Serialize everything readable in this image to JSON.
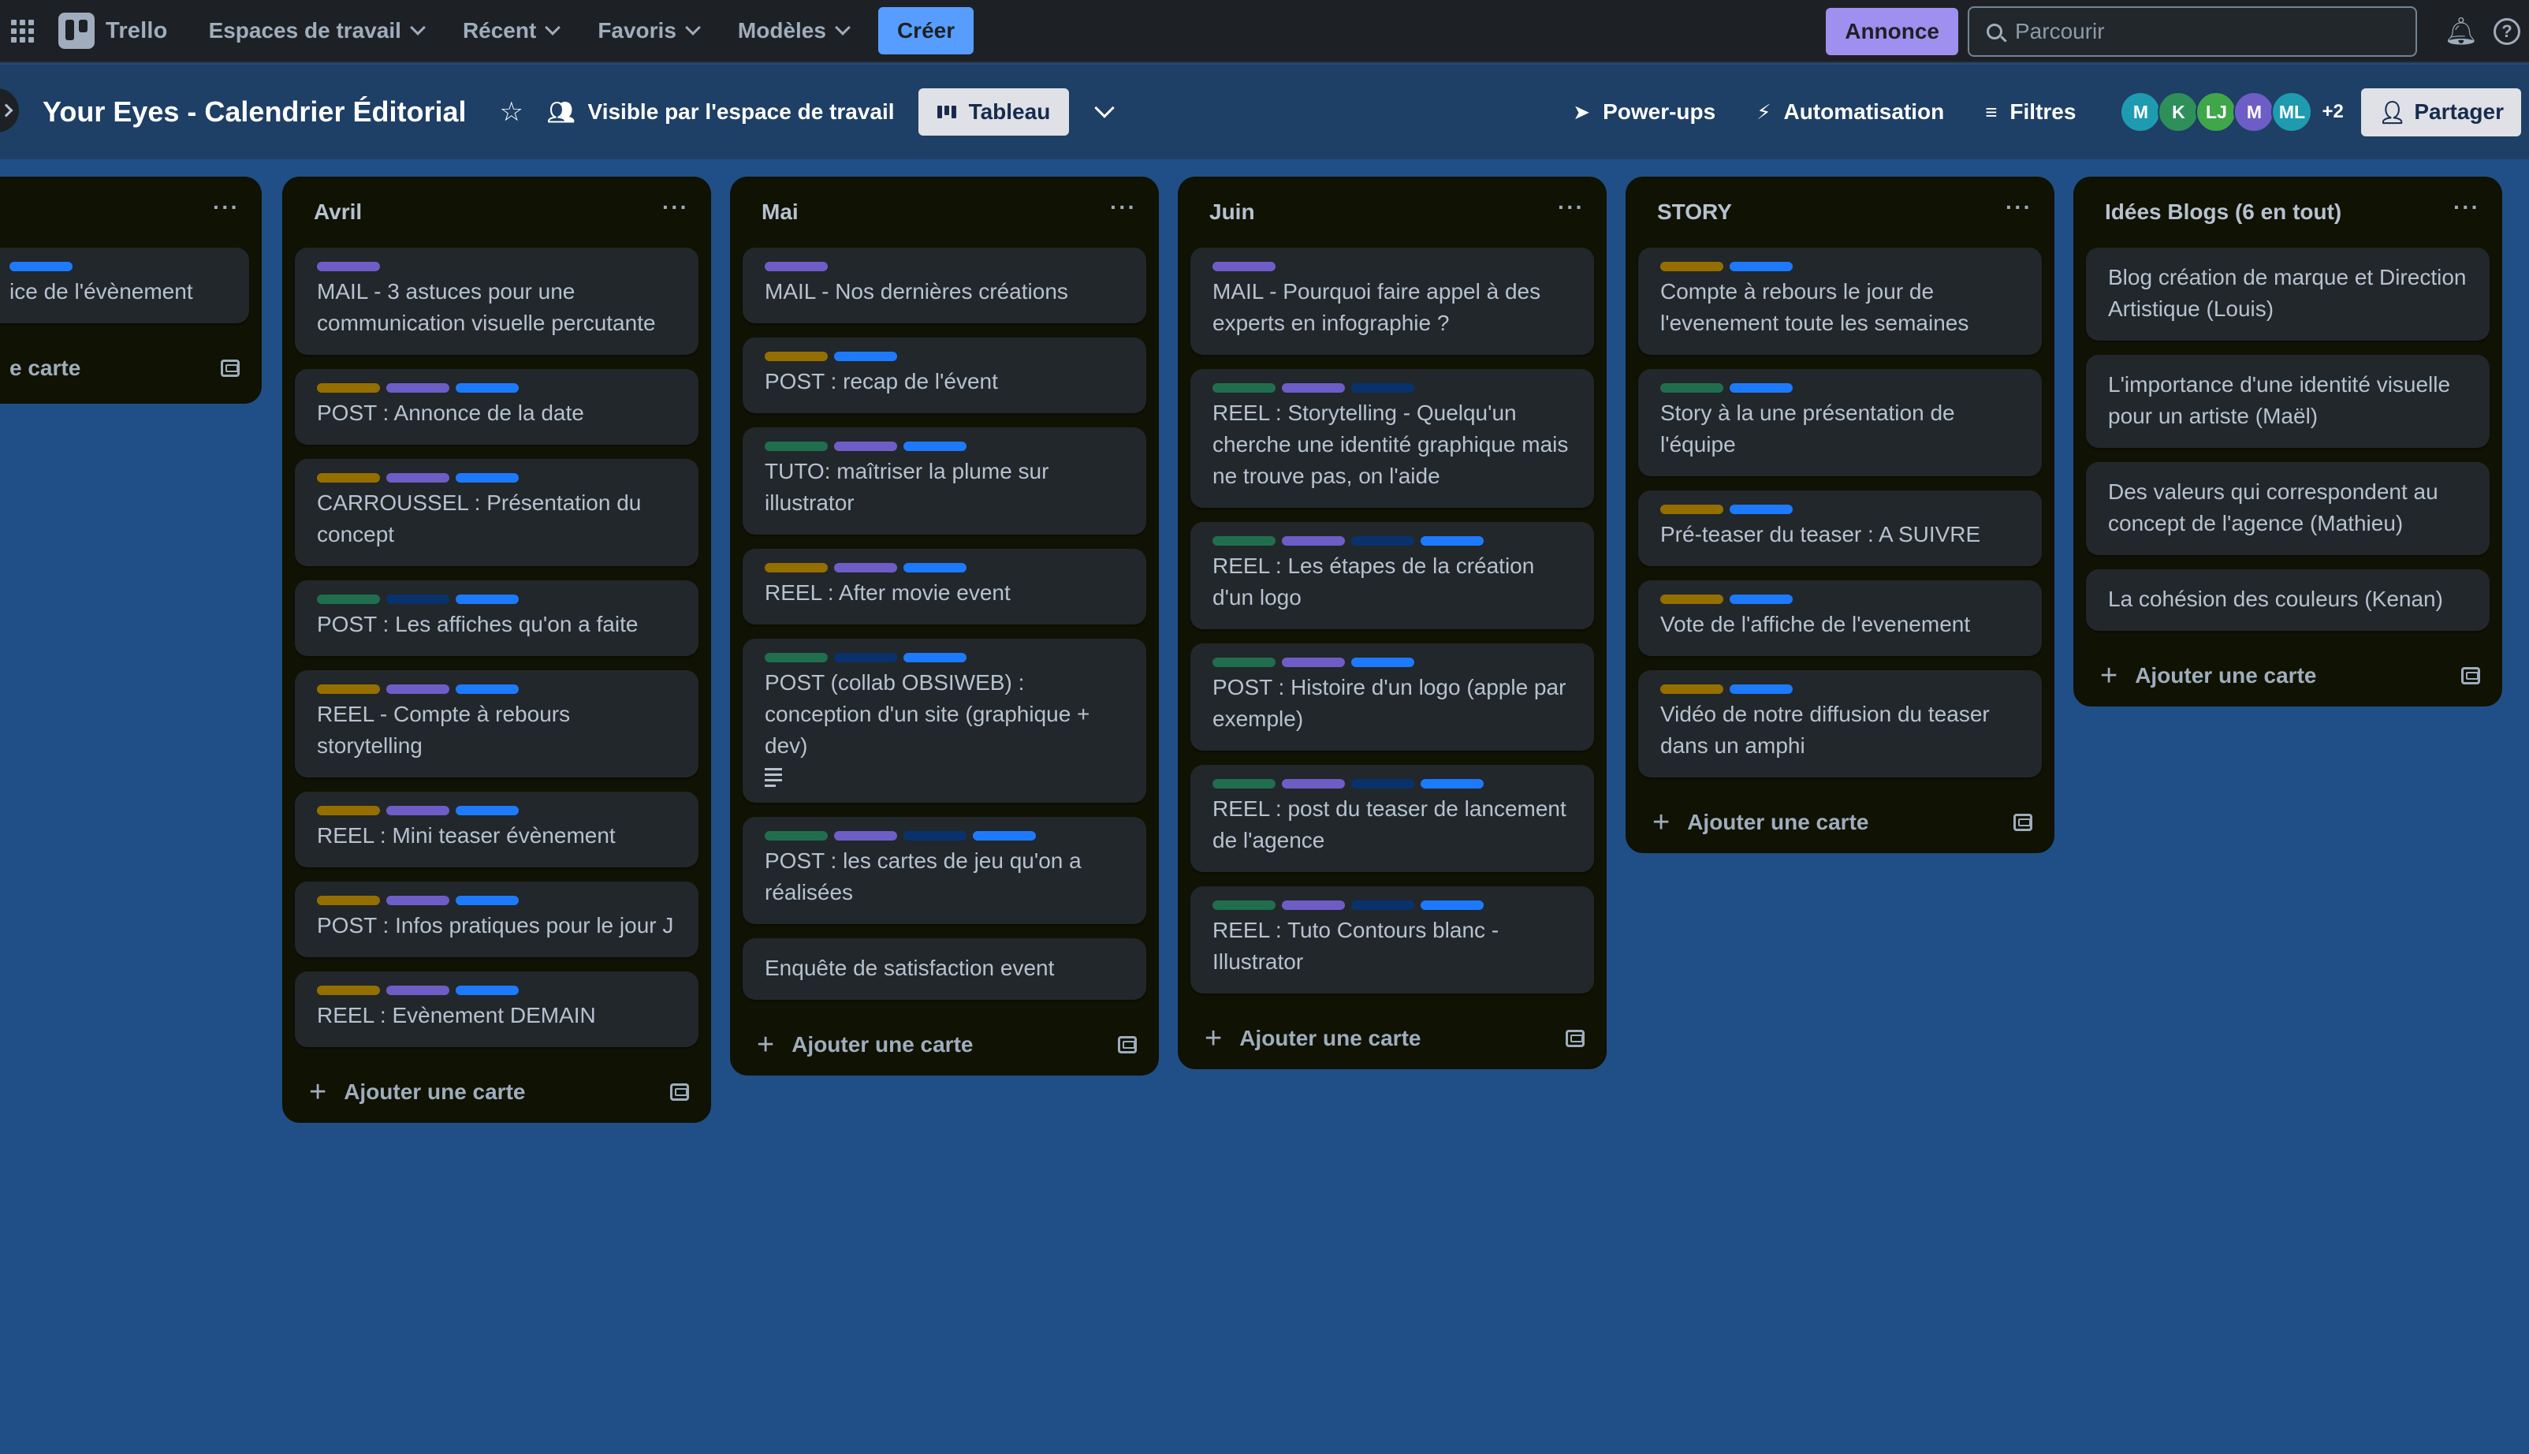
{
  "topnav": {
    "logo": "Trello",
    "menu": [
      "Espaces de travail",
      "Récent",
      "Favoris",
      "Modèles"
    ],
    "create": "Créer",
    "announce": "Annonce",
    "search_placeholder": "Parcourir"
  },
  "board": {
    "title": "Your Eyes - Calendrier Éditorial",
    "visibility": "Visible par l'espace de travail",
    "view": "Tableau",
    "powerups": "Power-ups",
    "automation": "Automatisation",
    "filters": "Filtres",
    "members": [
      {
        "initials": "M",
        "color": "#1f9bb0"
      },
      {
        "initials": "K",
        "color": "#2f8f5b"
      },
      {
        "initials": "LJ",
        "color": "#3fa64a"
      },
      {
        "initials": "M",
        "color": "#6e5dc6"
      },
      {
        "initials": "ML",
        "color": "#1f9bb0"
      }
    ],
    "more_members": "+2",
    "share": "Partager"
  },
  "add_card_label": "Ajouter une carte",
  "partial_list": {
    "card_fragment": "ice de l'évènement",
    "add_fragment": "e carte",
    "labels": [
      "blue"
    ]
  },
  "lists": [
    {
      "title": "Avril",
      "cards": [
        {
          "text": "MAIL - 3 astuces pour une communication visuelle percutante",
          "labels": [
            "purple"
          ]
        },
        {
          "text": "POST : Annonce de la date",
          "labels": [
            "yellow",
            "purple",
            "blue"
          ]
        },
        {
          "text": "CARROUSSEL : Présentation du concept",
          "labels": [
            "yellow",
            "purple",
            "blue"
          ]
        },
        {
          "text": "POST : Les affiches qu'on a faite",
          "labels": [
            "green",
            "navy",
            "blue"
          ]
        },
        {
          "text": "REEL - Compte à rebours storytelling",
          "labels": [
            "yellow",
            "purple",
            "blue"
          ]
        },
        {
          "text": "REEL : Mini teaser évènement",
          "labels": [
            "yellow",
            "purple",
            "blue"
          ]
        },
        {
          "text": "POST : Infos pratiques pour le jour J",
          "labels": [
            "yellow",
            "purple",
            "blue"
          ]
        },
        {
          "text": "REEL : Evènement DEMAIN",
          "labels": [
            "yellow",
            "purple",
            "blue"
          ]
        }
      ]
    },
    {
      "title": "Mai",
      "cards": [
        {
          "text": "MAIL - Nos dernières créations",
          "labels": [
            "purple"
          ]
        },
        {
          "text": "POST : recap de l'évent",
          "labels": [
            "yellow",
            "blue"
          ]
        },
        {
          "text": "TUTO: maîtriser la plume sur illustrator",
          "labels": [
            "green",
            "purple",
            "blue"
          ]
        },
        {
          "text": "REEL : After movie event",
          "labels": [
            "yellow",
            "purple",
            "blue"
          ]
        },
        {
          "text": "POST (collab OBSIWEB) : conception d'un site (graphique + dev)",
          "labels": [
            "green",
            "navy",
            "blue"
          ],
          "has_description": true
        },
        {
          "text": "POST : les cartes de jeu qu'on a réalisées",
          "labels": [
            "green",
            "purple",
            "navy",
            "blue"
          ]
        },
        {
          "text": "Enquête de satisfaction event",
          "labels": []
        }
      ]
    },
    {
      "title": "Juin",
      "cards": [
        {
          "text": "MAIL - Pourquoi faire appel à des experts en infographie ?",
          "labels": [
            "purple"
          ]
        },
        {
          "text": "REEL : Storytelling - Quelqu'un cherche une identité graphique mais ne trouve pas, on l'aide",
          "labels": [
            "green",
            "purple",
            "navy"
          ]
        },
        {
          "text": "REEL : Les étapes de la création d'un logo",
          "labels": [
            "green",
            "purple",
            "navy",
            "blue"
          ]
        },
        {
          "text": "POST : Histoire d'un logo (apple par exemple)",
          "labels": [
            "green",
            "purple",
            "blue"
          ]
        },
        {
          "text": "REEL : post du teaser de lancement de l'agence",
          "labels": [
            "green",
            "purple",
            "navy",
            "blue"
          ]
        },
        {
          "text": "REEL : Tuto Contours blanc - Illustrator",
          "labels": [
            "green",
            "purple",
            "navy",
            "blue"
          ]
        }
      ]
    },
    {
      "title": "STORY",
      "cards": [
        {
          "text": "Compte à rebours le jour de l'evenement toute les semaines",
          "labels": [
            "yellow",
            "blue"
          ]
        },
        {
          "text": "Story à la une présentation de l'équipe",
          "labels": [
            "green",
            "blue"
          ]
        },
        {
          "text": "Pré-teaser du teaser : A SUIVRE",
          "labels": [
            "yellow",
            "blue"
          ]
        },
        {
          "text": "Vote de l'affiche de l'evenement",
          "labels": [
            "yellow",
            "blue"
          ]
        },
        {
          "text": "Vidéo de notre diffusion du teaser dans un amphi",
          "labels": [
            "yellow",
            "blue"
          ]
        }
      ]
    },
    {
      "title": "Idées Blogs (6 en tout)",
      "cards": [
        {
          "text": "Blog création de marque et Direction Artistique (Louis)",
          "labels": []
        },
        {
          "text": "L'importance d'une identité visuelle pour un artiste (Maël)",
          "labels": []
        },
        {
          "text": "Des valeurs qui correspondent au concept de l'agence (Mathieu)",
          "labels": []
        },
        {
          "text": "La cohésion des couleurs (Kenan)",
          "labels": []
        }
      ]
    }
  ]
}
